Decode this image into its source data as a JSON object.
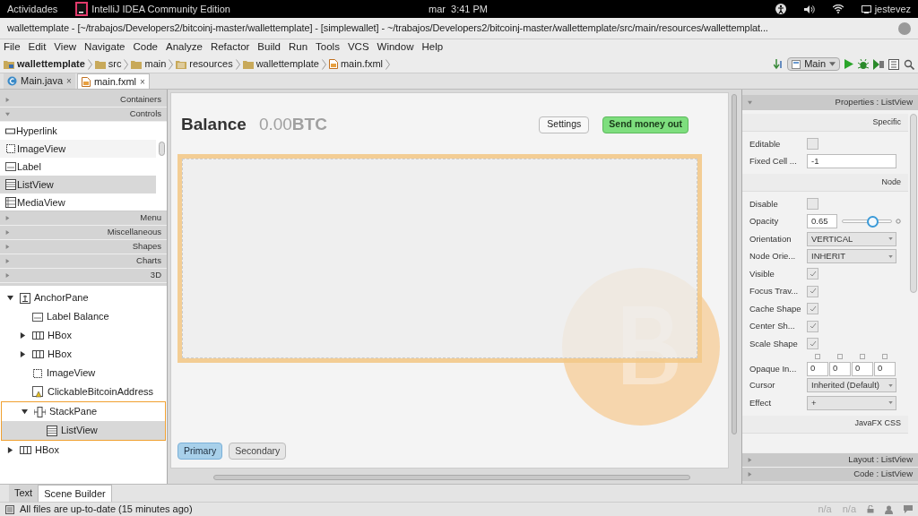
{
  "top_bar": {
    "activities": "Actividades",
    "app": "IntelliJ IDEA Community Edition",
    "clock": "mar  3:41 PM",
    "user": "jestevez"
  },
  "window": {
    "title": "wallettemplate - [~/trabajos/Developers2/bitcoinj-master/wallettemplate] - [simplewallet] - ~/trabajos/Developers2/bitcoinj-master/wallettemplate/src/main/resources/wallettemplat..."
  },
  "menu": [
    "File",
    "Edit",
    "View",
    "Navigate",
    "Code",
    "Analyze",
    "Refactor",
    "Build",
    "Run",
    "Tools",
    "VCS",
    "Window",
    "Help"
  ],
  "breadcrumbs": [
    {
      "label": "wallettemplate",
      "kind": "module"
    },
    {
      "label": "src",
      "kind": "folder"
    },
    {
      "label": "main",
      "kind": "folder"
    },
    {
      "label": "resources",
      "kind": "resources"
    },
    {
      "label": "wallettemplate",
      "kind": "folder"
    },
    {
      "label": "main.fxml",
      "kind": "file"
    }
  ],
  "run_config": "Main",
  "editor_tabs": [
    {
      "label": "Main.java",
      "kind": "java",
      "selected": false,
      "close": "×"
    },
    {
      "label": "main.fxml",
      "kind": "fxml",
      "selected": true,
      "close": "×"
    }
  ],
  "library": {
    "sections_top": [
      {
        "label": "Containers",
        "expanded": false
      },
      {
        "label": "Controls",
        "expanded": true
      }
    ],
    "items": [
      {
        "label": "Hyperlink",
        "kind": "link",
        "selected": false
      },
      {
        "label": "ImageView",
        "kind": "image",
        "selected": false
      },
      {
        "label": "Label",
        "kind": "label",
        "selected": false
      },
      {
        "label": "ListView",
        "kind": "list",
        "selected": true
      },
      {
        "label": "MediaView",
        "kind": "media",
        "selected": false
      }
    ],
    "sections_bottom": [
      {
        "label": "Menu",
        "expanded": false
      },
      {
        "label": "Miscellaneous",
        "expanded": false
      },
      {
        "label": "Shapes",
        "expanded": false
      },
      {
        "label": "Charts",
        "expanded": false
      },
      {
        "label": "3D",
        "expanded": false
      }
    ]
  },
  "hierarchy": [
    {
      "label": "AnchorPane",
      "kind": "anchor",
      "expanded": true,
      "selected": false,
      "children": [
        {
          "label": "Label Balance",
          "kind": "label",
          "selected": false
        },
        {
          "label": "HBox",
          "kind": "hbox",
          "expanded": false,
          "selected": false
        },
        {
          "label": "HBox",
          "kind": "hbox",
          "expanded": false,
          "selected": false
        },
        {
          "label": "ImageView",
          "kind": "image",
          "selected": false
        },
        {
          "label": "ClickableBitcoinAddress",
          "kind": "custom",
          "selected": false
        },
        {
          "label": "StackPane",
          "kind": "stack",
          "expanded": true,
          "selected": false,
          "children": [
            {
              "label": "ListView",
              "kind": "list",
              "selected": true
            }
          ]
        }
      ]
    },
    {
      "label": "HBox",
      "kind": "hbox",
      "expanded": false,
      "selected": false
    }
  ],
  "canvas": {
    "balance_label": "Balance",
    "amount": "0.00",
    "unit": "BTC",
    "settings_button": "Settings",
    "send_button": "Send money out",
    "bottom_buttons": [
      {
        "label": "Primary",
        "selected": true
      },
      {
        "label": "Secondary",
        "selected": false
      }
    ]
  },
  "properties": {
    "title": "Properties : ListView",
    "rows": [
      {
        "kind": "section",
        "label": "Specific"
      },
      {
        "kind": "checkbox",
        "label": "Editable",
        "checked": false
      },
      {
        "kind": "field",
        "label": "Fixed Cell ...",
        "value": "-1"
      },
      {
        "kind": "section",
        "label": "Node"
      },
      {
        "kind": "checkbox",
        "label": "Disable",
        "checked": false
      },
      {
        "kind": "slider",
        "label": "Opacity",
        "value": "0.65",
        "level": 0.65
      },
      {
        "kind": "dropdown",
        "label": "Orientation",
        "value": "VERTICAL"
      },
      {
        "kind": "dropdown",
        "label": "Node Orie...",
        "value": "INHERIT"
      },
      {
        "kind": "checkbox",
        "label": "Visible",
        "checked": true
      },
      {
        "kind": "checkbox",
        "label": "Focus Trav...",
        "checked": true
      },
      {
        "kind": "checkbox",
        "label": "Cache Shape",
        "checked": true
      },
      {
        "kind": "checkbox",
        "label": "Center Sh...",
        "checked": true
      },
      {
        "kind": "checkbox",
        "label": "Scale Shape",
        "checked": true
      },
      {
        "kind": "insets",
        "label": "Opaque In...",
        "values": [
          "0",
          "0",
          "0",
          "0"
        ]
      },
      {
        "kind": "dropdown",
        "label": "Cursor",
        "value": "Inherited (Default)"
      },
      {
        "kind": "dropdown",
        "label": "Effect",
        "value": "+"
      },
      {
        "kind": "section",
        "label": "JavaFX CSS"
      }
    ],
    "collapsed": [
      "Layout : ListView",
      "Code : ListView"
    ]
  },
  "bottom_tabs": [
    {
      "label": "Text",
      "selected": false
    },
    {
      "label": "Scene Builder",
      "selected": true
    }
  ],
  "status_bar": {
    "message": "All files are up-to-date (15 minutes ago)",
    "readouts": [
      "n/a",
      "n/a"
    ]
  }
}
